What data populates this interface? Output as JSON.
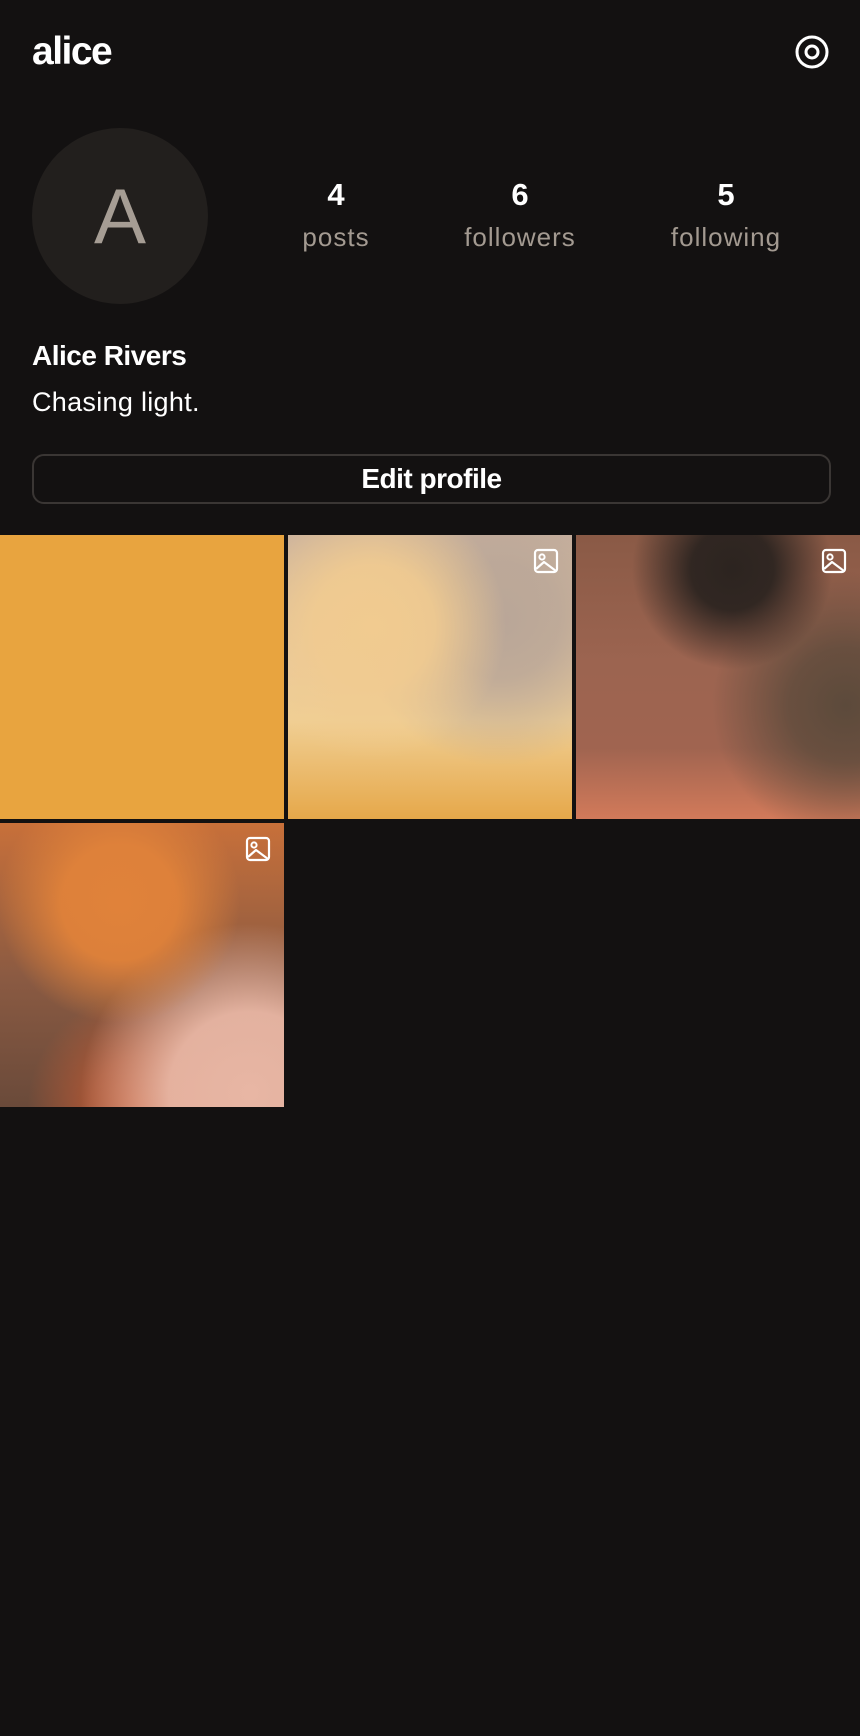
{
  "header": {
    "username": "alice",
    "settings_icon": "settings-icon"
  },
  "profile": {
    "avatar_initial": "A",
    "stats": {
      "posts_count": "4",
      "posts_label": "posts",
      "followers_count": "6",
      "followers_label": "followers",
      "following_count": "5",
      "following_label": "following"
    },
    "display_name": "Alice Rivers",
    "bio": "Chasing light.",
    "edit_label": "Edit profile"
  },
  "grid": {
    "posts": [
      {
        "has_multi_icon": false
      },
      {
        "has_multi_icon": true
      },
      {
        "has_multi_icon": true
      },
      {
        "has_multi_icon": true
      }
    ]
  },
  "colors": {
    "background": "#131111",
    "avatar_bg": "#221f1d",
    "muted_text": "#a39a91"
  }
}
